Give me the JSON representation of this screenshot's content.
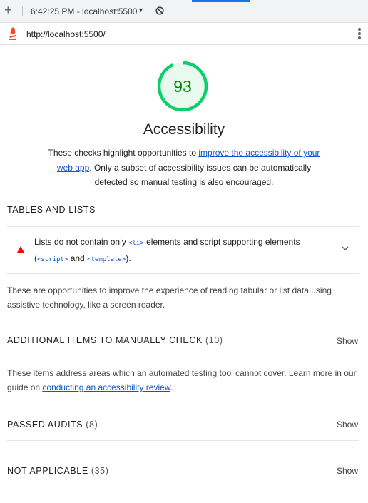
{
  "toolbar": {
    "new_tab_icon": "plus-icon",
    "session_label": "6:42:25 PM - localhost:5500",
    "dropdown_icon": "caret-down-icon",
    "clear_icon": "block-icon"
  },
  "urlbar": {
    "logo_icon": "lighthouse-icon",
    "url": "http://localhost:5500/",
    "menu_icon": "kebab-menu-icon"
  },
  "category": {
    "score": "93",
    "score_color": "#0cce6b",
    "title": "Accessibility",
    "desc_pre": "These checks highlight opportunities to ",
    "desc_link": "improve the accessibility of your web app",
    "desc_post": ". Only a subset of accessibility issues can be automatically detected so manual testing is also encouraged."
  },
  "tables_lists": {
    "heading": "TABLES AND LISTS",
    "audit": {
      "status_icon": "fail-triangle-icon",
      "status_color": "#eb0f00",
      "text_1": "Lists do not contain only ",
      "code_li": "<li>",
      "text_2": " elements and script supporting elements",
      "text_3": "(",
      "code_script": "<script>",
      "text_4": " and ",
      "code_template": "<template>",
      "text_5": ").",
      "expand_icon": "chevron-down-icon"
    },
    "description": "These are opportunities to improve the experience of reading tabular or list data using assistive technology, like a screen reader."
  },
  "manual": {
    "heading": "ADDITIONAL ITEMS TO MANUALLY CHECK",
    "count": "(10)",
    "show_label": "Show",
    "desc_pre": "These items address areas which an automated testing tool cannot cover. Learn more in our guide on ",
    "desc_link": "conducting an accessibility review",
    "desc_post": "."
  },
  "passed": {
    "heading": "PASSED AUDITS",
    "count": "(8)",
    "show_label": "Show"
  },
  "not_applicable": {
    "heading": "NOT APPLICABLE",
    "count": "(35)",
    "show_label": "Show"
  }
}
